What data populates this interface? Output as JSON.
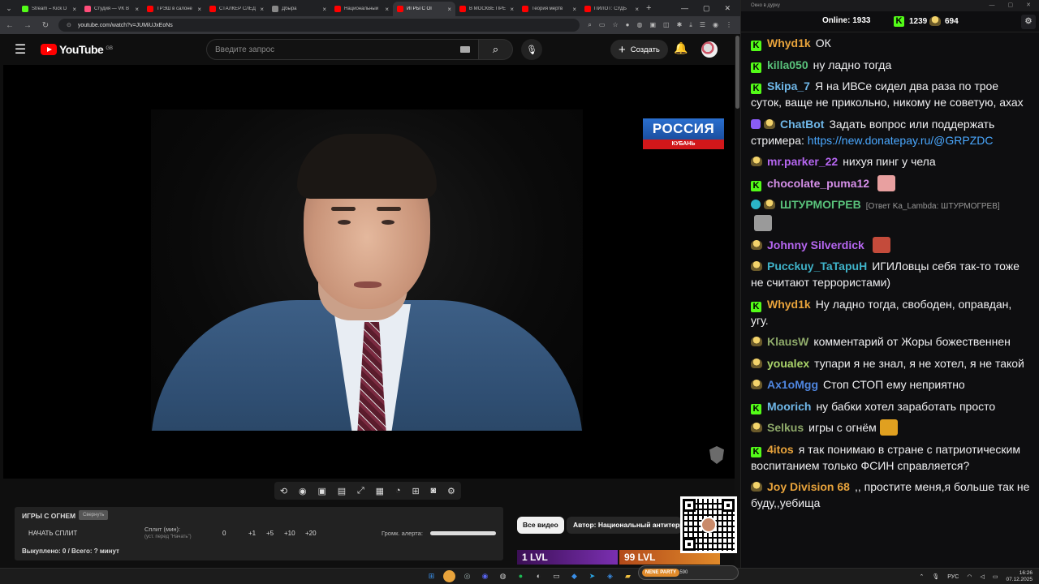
{
  "browser": {
    "tabs": [
      {
        "title": "Stream – Kick D",
        "color": "#53fc18",
        "active": false
      },
      {
        "title": "Студия — VK В",
        "color": "#ff4d7a",
        "active": false
      },
      {
        "title": "ТРЭШ в салоне",
        "color": "#ff0000",
        "active": false
      },
      {
        "title": "СТАЛКЕР СЛЕД",
        "color": "#ff0000",
        "active": false
      },
      {
        "title": "Дбыра",
        "color": "#888888",
        "active": false
      },
      {
        "title": "Национальный",
        "color": "#ff0000",
        "active": false
      },
      {
        "title": "ИГРЫ С ОГ",
        "color": "#ff0000",
        "active": true
      },
      {
        "title": "В МОСКВЕ ПРЕ",
        "color": "#ff0000",
        "active": false
      },
      {
        "title": "Теория мертв",
        "color": "#ff0000",
        "active": false
      },
      {
        "title": "ПИЛОТ: СУДЬ",
        "color": "#ff0000",
        "active": false
      }
    ],
    "url": "youtube.com/watch?v=JUMiUJxEoNs"
  },
  "youtube": {
    "logo_text": "YouTube",
    "country_code": "GB",
    "search_placeholder": "Введите запрос",
    "create_label": "Создать"
  },
  "video": {
    "channel_logo_top": "РОССИЯ",
    "channel_logo_bottom": "КУБАНЬ"
  },
  "split_panel": {
    "title": "ИГРЫ С ОГНЕМ",
    "minimize_label": "Свернуть",
    "start_label": "НАЧАТЬ СПЛИТ",
    "split_label": "Сплит (мин):",
    "split_hint": "(уст. перед \"Начать\")",
    "split_value": "0",
    "increments": [
      "+1",
      "+5",
      "+10",
      "+20"
    ],
    "volume_label": "Громк. алерта:",
    "volume_level": 1.0,
    "bought_text": "Выкуплено: 0 / Всего: ? минут"
  },
  "chips": {
    "all_videos": "Все видео",
    "author": "Автор: Национальный антитерр"
  },
  "lvl_strip": {
    "left_label": "1 LVL",
    "right_label": "99 LVL"
  },
  "chat": {
    "window_title": "Окно в дурку",
    "online_label": "Online:",
    "online_count": "1933",
    "kick_count": "1239",
    "gold_count": "694",
    "messages": [
      {
        "badges": [
          "kick"
        ],
        "user": "Whyd1k",
        "color": "#e8a33b",
        "text": "ОК"
      },
      {
        "badges": [
          "kick"
        ],
        "user": "killa050",
        "color": "#59c27b",
        "text": "ну ладно тогда"
      },
      {
        "badges": [
          "kick"
        ],
        "user": "Skipa_7",
        "color": "#6fb7e8",
        "text": "Я на ИВСе сидел два раза по трое суток, ваще не прикольно, никому не советую, ахах"
      },
      {
        "badges": [
          "bot",
          "gold"
        ],
        "user": "ChatBot",
        "color": "#6fb7e8",
        "text": "Задать вопрос или поддержать стримера: ",
        "link": "https://new.donatepay.ru/@GRPZDC"
      },
      {
        "badges": [
          "gold"
        ],
        "user": "mr.parker_22",
        "color": "#b566f0",
        "text": "нихуя пинг у чела"
      },
      {
        "badges": [
          "kick"
        ],
        "user": "chocolate_puma12",
        "color": "#d58fe8",
        "text": "",
        "emote": "#e8a0a0"
      },
      {
        "badges": [
          "verified",
          "gold"
        ],
        "user": "ШТУРМОГРЕВ",
        "color": "#59c27b",
        "text": "",
        "reply": "[Ответ Ka_Lambda: ШТУРМОГРЕВ]",
        "emote": "#9a9a9a"
      },
      {
        "badges": [
          "gold"
        ],
        "user": "Johnny Silverdick",
        "color": "#b566f0",
        "text": "",
        "emote": "#c44b3b"
      },
      {
        "badges": [
          "gold"
        ],
        "user": "Pucckuy_TaTapuH",
        "color": "#3fb2c8",
        "text": "ИГИЛовцы себя так-то тоже не считают террористами)"
      },
      {
        "badges": [
          "kick"
        ],
        "user": "Whyd1k",
        "color": "#e8a33b",
        "text": "Ну ладно тогда, свободен, оправдан, угу."
      },
      {
        "badges": [
          "gold"
        ],
        "user": "KlausW",
        "color": "#8faa6a",
        "text": "комментарий от Жоры божественнен"
      },
      {
        "badges": [
          "gold"
        ],
        "user": "youalex",
        "color": "#aad46a",
        "text": "тупари я не знал, я не хотел, я не такой"
      },
      {
        "badges": [
          "gold"
        ],
        "user": "Ax1oMgg",
        "color": "#4f86e0",
        "text": "Стоп СТОП ему неприятно"
      },
      {
        "badges": [
          "kick"
        ],
        "user": "Moorich",
        "color": "#6fb7e8",
        "text": "ну бабки хотел заработать просто"
      },
      {
        "badges": [
          "gold"
        ],
        "user": "Selkus",
        "color": "#8faa6a",
        "text": "игры с огнём",
        "emote": "#e0a020"
      },
      {
        "badges": [
          "kick"
        ],
        "user": "4itos",
        "color": "#e8a33b",
        "text": "я так понимаю в стране с патриотическим воспитанием только ФСИН справляется?"
      },
      {
        "badges": [
          "gold"
        ],
        "user": "Joy Division 68",
        "color": "#e8a33b",
        "text": ",, простите меня,я больше так не буду,,уебища"
      }
    ]
  },
  "taskbar": {
    "widget_label": "NENE PARTY",
    "widget_value": "650 / 1590",
    "lang": "РУС",
    "time": "16:26",
    "date": "07.12.2025"
  }
}
